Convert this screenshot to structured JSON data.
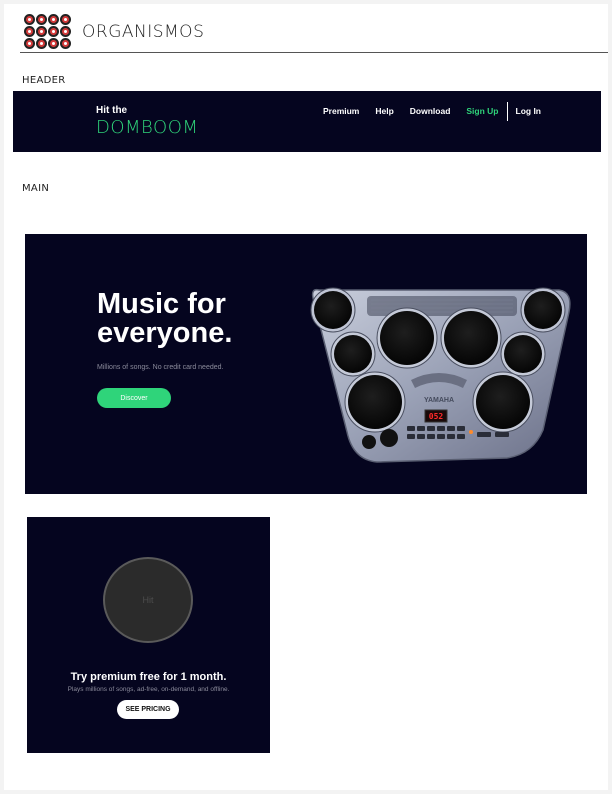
{
  "brand": {
    "name": "ORGANISMOS",
    "logo_icon": "drum-grid-logo"
  },
  "sections": {
    "header_label": "HEADER",
    "main_label": "MAIN"
  },
  "nav": {
    "brand_small": "Hit the",
    "brand_big": "DOMBOOM",
    "links": [
      {
        "label": "Premium"
      },
      {
        "label": "Help"
      },
      {
        "label": "Download"
      },
      {
        "label": "Sign Up",
        "accent": true
      },
      {
        "label": "Log In"
      }
    ]
  },
  "hero": {
    "title_line1": "Music for",
    "title_line2": "everyone.",
    "subtitle": "Millions of songs. No credit card needed.",
    "button_label": "Discover",
    "image_icon": "electronic-drum-pad-image",
    "device_brand": "YAMAHA",
    "display_value": "052"
  },
  "card": {
    "circle_text": "Hit",
    "title": "Try premium free for 1 month.",
    "subtitle": "Plays millions of songs, ad-free, on-demand, and offline.",
    "button_label": "SEE PRICING"
  },
  "colors": {
    "dark_bg": "#05051f",
    "accent_green": "#2fd47a",
    "logo_red": "#d33a3a"
  }
}
